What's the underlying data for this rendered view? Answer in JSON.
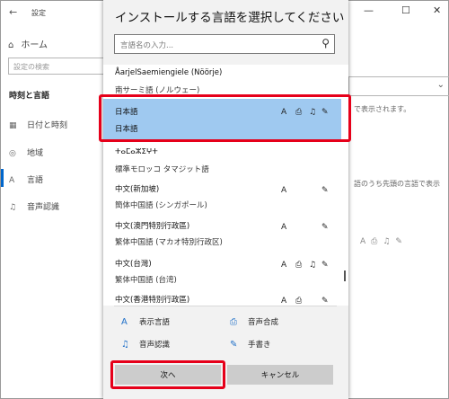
{
  "settings": {
    "window_title": "設定",
    "back_icon": "←",
    "home": "ホーム",
    "search_placeholder": "設定の検索",
    "section": "時刻と言語",
    "nav": [
      {
        "icon": "calendar-icon",
        "glyph": "▦",
        "label": "日付と時刻"
      },
      {
        "icon": "globe-icon",
        "glyph": "◎",
        "label": "地域"
      },
      {
        "icon": "language-icon",
        "glyph": "A",
        "label": "言語"
      },
      {
        "icon": "microphone-icon",
        "glyph": "♫",
        "label": "音声認識"
      }
    ],
    "background_text_1": "で表示されます。",
    "background_text_2": "語のうち先頭の言語で表示"
  },
  "dialog": {
    "title": "インストールする言語を選択してください",
    "search_placeholder": "言語名の入力...",
    "languages": [
      {
        "name": "ÅarjelSaemiengiele (Nöörje)",
        "native": "南サーミ語 (ノルウェー)",
        "features": [],
        "selected": false
      },
      {
        "name": "日本語",
        "native": "日本語",
        "features": [
          "display",
          "speech",
          "recognition",
          "handwriting"
        ],
        "selected": true
      },
      {
        "name": "ⵜⴰⵎⴰⵣⵉⵖⵜ",
        "native": "標準モロッコ タマジット語",
        "features": [],
        "selected": false
      },
      {
        "name": "中文(新加坡)",
        "native": "簡体中国語 (シンガポール)",
        "features": [
          "display",
          "handwriting"
        ],
        "selected": false
      },
      {
        "name": "中文(澳門特別行政區)",
        "native": "繁体中国語 (マカオ特別行政区)",
        "features": [
          "display",
          "handwriting"
        ],
        "selected": false
      },
      {
        "name": "中文(台灣)",
        "native": "繁体中国語 (台湾)",
        "features": [
          "display",
          "speech",
          "recognition",
          "handwriting"
        ],
        "selected": false
      },
      {
        "name": "中文(香港特別行政區)",
        "native": "",
        "features": [
          "display",
          "speech",
          "handwriting"
        ],
        "selected": false
      }
    ],
    "legend": {
      "display": "表示言語",
      "speech": "音声合成",
      "recognition": "音声認識",
      "handwriting": "手書き"
    },
    "next_button": "次へ",
    "cancel_button": "キャンセル"
  },
  "colors": {
    "selected_row": "#9fc9f0",
    "highlight_box": "#e6001a",
    "accent": "#1e6fc8"
  }
}
